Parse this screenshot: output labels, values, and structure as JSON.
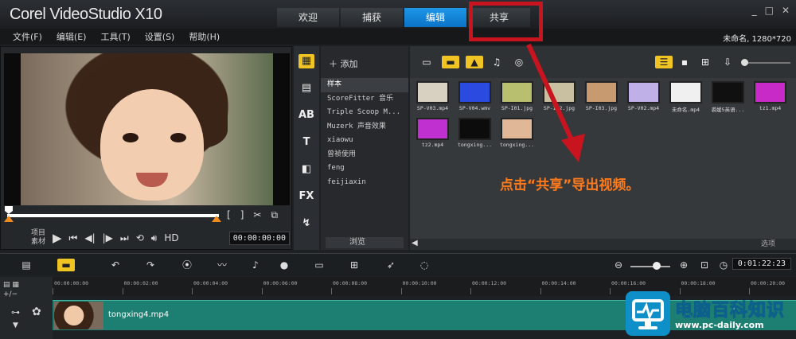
{
  "app": {
    "brand": "Corel VideoStudio X10",
    "tabs": [
      "欢迎",
      "捕获",
      "编辑",
      "共享"
    ],
    "active_tab": "编辑",
    "window_controls": [
      "_",
      "□",
      "✕"
    ]
  },
  "menu": [
    "文件(F)",
    "编辑(E)",
    "工具(T)",
    "设置(S)",
    "帮助(H)"
  ],
  "project_info": "未命名, 1280*720",
  "preview": {
    "mode_labels": [
      "项目",
      "素材"
    ],
    "hd_label": "HD",
    "timecode": "00:00:00:00",
    "mark_brackets": [
      "[",
      "]"
    ]
  },
  "library": {
    "side_icons": [
      "media-icon",
      "instant-project-icon",
      "transition-icon",
      "title-icon",
      "graphic-icon",
      "fx-icon",
      "path-icon"
    ],
    "add_label": "添加",
    "folders": [
      "样本",
      "ScoreFitter 音乐",
      "Triple Scoop M...",
      "Muzerk 声音效果",
      "xiaowu",
      "曾祯使用",
      "feng",
      "feijiaxin"
    ],
    "selected_folder": "样本",
    "browse_label": "浏览",
    "options_label": "选项"
  },
  "media": [
    {
      "caption": "SP-V03.mp4",
      "color": "#d8d0c0"
    },
    {
      "caption": "SP-V04.wmv",
      "color": "#2a4ae0"
    },
    {
      "caption": "SP-I01.jpg",
      "color": "#b8c070"
    },
    {
      "caption": "SP-I02.jpg",
      "color": "#c8c0a0"
    },
    {
      "caption": "SP-I03.jpg",
      "color": "#c89a70"
    },
    {
      "caption": "SP-V02.mp4",
      "color": "#c0b0e8"
    },
    {
      "caption": "未命名.mp4",
      "color": "#f0f0f0"
    },
    {
      "caption": "裘媛5英语...",
      "color": "#101010"
    },
    {
      "caption": "tz1.mp4",
      "color": "#c82ac8"
    },
    {
      "caption": "tz2.mp4",
      "color": "#c030d0"
    },
    {
      "caption": "tongxing...",
      "color": "#0c0c0c"
    },
    {
      "caption": "tongxing...",
      "color": "#e0b898"
    }
  ],
  "annotation": "点击“共享”导出视频。",
  "timeline": {
    "timecode": "0:01:22:23",
    "ruler": [
      "00:00:00:00",
      "00:00:02:00",
      "00:00:04:00",
      "00:00:06:00",
      "00:00:08:00",
      "00:00:10:00",
      "00:00:12:00",
      "00:00:14:00",
      "00:00:16:00",
      "00:00:18:00",
      "00:00:20:00"
    ],
    "clip_name": "tongxing4.mp4"
  },
  "watermark": {
    "title": "电脑百科知识",
    "url": "www.pc-daily.com"
  },
  "colors": {
    "active_tab": "#0b73c7",
    "highlight": "#f0c423",
    "annotation": "#ff7a1a",
    "callout_red": "#c8141e",
    "track": "#1d7f71"
  }
}
